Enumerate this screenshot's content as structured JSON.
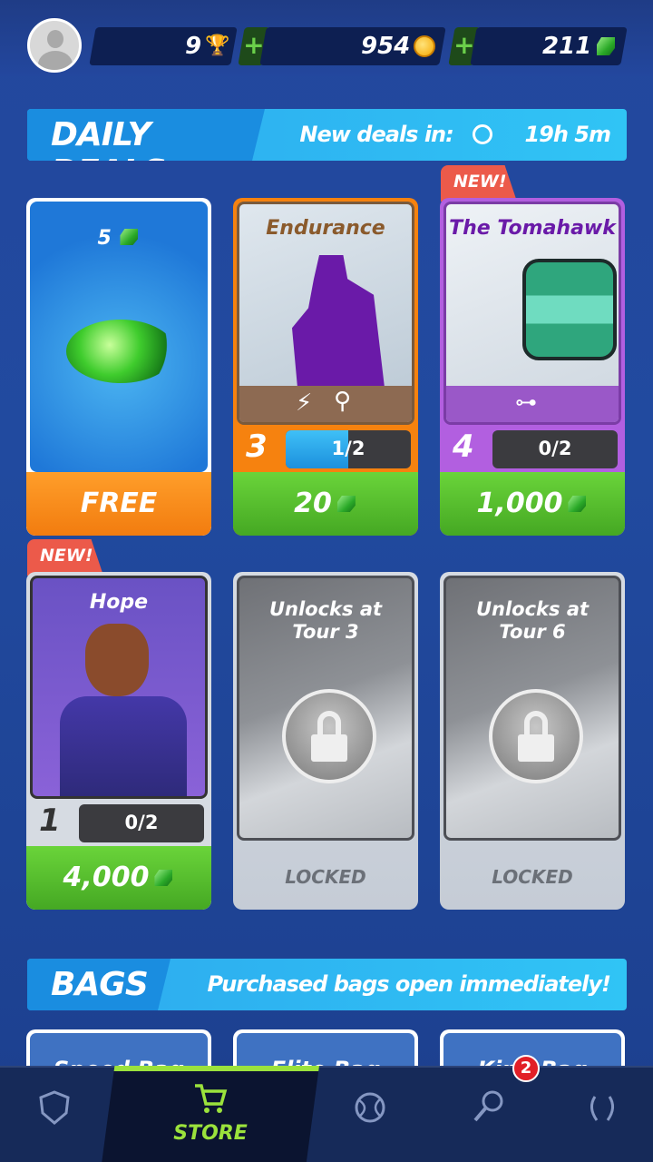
{
  "header": {
    "trophies": "9",
    "coins": "954",
    "gems": "211",
    "plus_label": "+"
  },
  "daily_deals": {
    "title": "DAILY DEALS",
    "timer_label": "New deals in:",
    "timer_value": "19h 5m",
    "cards": [
      {
        "type": "gems",
        "amount": "5",
        "price": "FREE"
      },
      {
        "type": "card",
        "name": "Endurance",
        "level": "3",
        "progress": "1/2",
        "progress_fraction": 0.5,
        "price": "20"
      },
      {
        "type": "card",
        "name": "The Tomahawk",
        "level": "4",
        "progress": "0/2",
        "progress_fraction": 0,
        "price": "1,000",
        "new": "NEW!"
      },
      {
        "type": "card",
        "name": "Hope",
        "level": "1",
        "progress": "0/2",
        "progress_fraction": 0,
        "price": "4,000",
        "new": "NEW!"
      },
      {
        "type": "locked",
        "unlock_text": "Unlocks at Tour 3",
        "footer": "LOCKED"
      },
      {
        "type": "locked",
        "unlock_text": "Unlocks at Tour 6",
        "footer": "LOCKED"
      }
    ]
  },
  "bags": {
    "title": "BAGS",
    "subtitle": "Purchased bags open immediately!",
    "items": [
      "Speed Bag",
      "Elite Bag",
      "King Bag"
    ]
  },
  "nav": {
    "store_label": "STORE",
    "badge_count": "2",
    "active": "store"
  },
  "colors": {
    "background": "#23479e",
    "accent_green": "#9be23c",
    "free_orange": "#f7931e",
    "price_green": "#4fb52a"
  }
}
